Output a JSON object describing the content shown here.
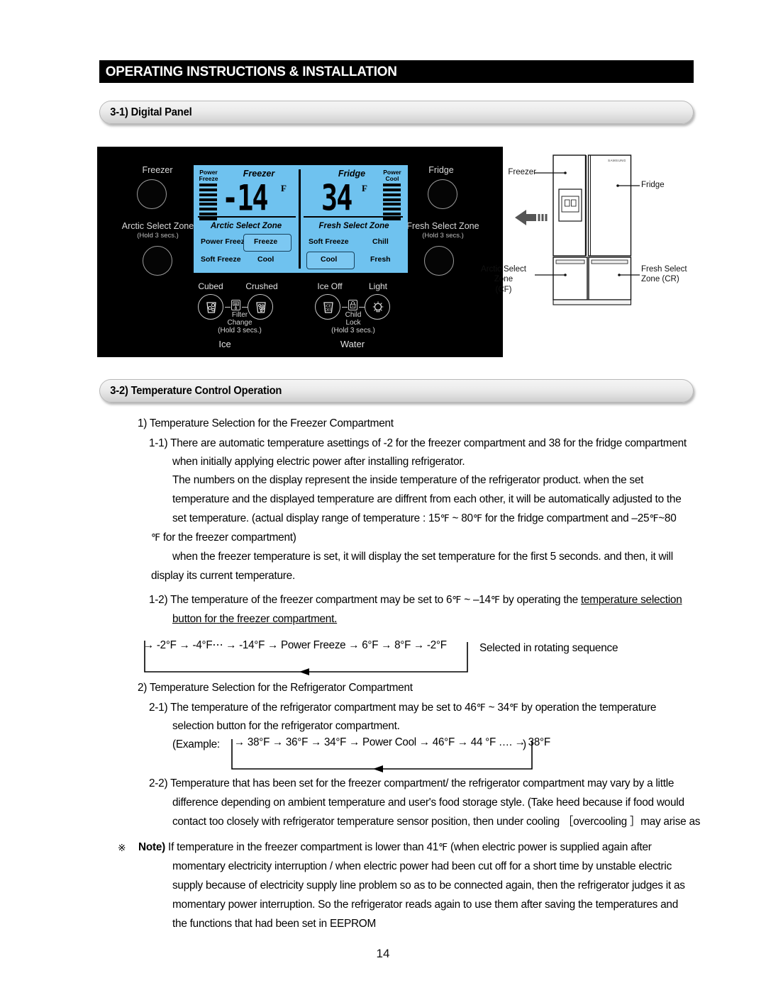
{
  "header": {
    "title": "OPERATING INSTRUCTIONS & INSTALLATION"
  },
  "sections": {
    "digital_panel": "3-1) Digital Panel",
    "temperature_control": "3-2) Temperature Control Operation"
  },
  "digital_panel": {
    "left_controls": [
      {
        "label": "Freezer",
        "sub": ""
      },
      {
        "label": "Arctic Select Zone",
        "sub": "(Hold 3 secs.)"
      }
    ],
    "right_controls": [
      {
        "label": "Fridge",
        "sub": ""
      },
      {
        "label": "Fresh Select Zone",
        "sub": "(Hold 3 secs.)"
      }
    ],
    "lcd": {
      "power_freeze_label": "Power\nFreeze",
      "power_cool_label": "Power\nCool",
      "freezer_title": "Freezer",
      "fridge_title": "Fridge",
      "freezer_value": "-14",
      "freezer_unit": "F",
      "fridge_value": "34",
      "fridge_unit": "F",
      "arctic_zone_title": "Arctic Select Zone",
      "fresh_zone_title": "Fresh Select Zone",
      "arctic_items": [
        "Power Freeze",
        "Freeze",
        "Soft Freeze",
        "Cool"
      ],
      "arctic_selected": "Freeze",
      "fresh_items": [
        "Soft Freeze",
        "Chill",
        "Cool",
        "Fresh"
      ],
      "fresh_selected": "Cool",
      "bar_count": 8,
      "lcd_color": "#6fc2ef"
    },
    "dispenser": {
      "cubed": "Cubed",
      "crushed": "Crushed",
      "ice_off": "Ice Off",
      "light": "Light",
      "filter_change": "Filter\nChange\n(Hold 3 secs.)",
      "child_lock": "Child\nLock\n(Hold 3 secs.)",
      "ice_group": "Ice",
      "water_group": "Water",
      "ice_off_glyph": "ICE\nOFF"
    }
  },
  "fridge_diagram": {
    "brand": "SAMSUNG",
    "callouts": {
      "freezer": "Freezer",
      "fridge": "Fridge",
      "arctic": "Arctic Select Zone\n(CF)",
      "fresh": "Fresh Select\nZone (CR)"
    }
  },
  "body": {
    "item1_head": "1) Temperature Selection for the Freezer Compartment",
    "item1_1_l1": "1-1) There are automatic temperature asettings of -2 for the freezer compartment and 38 for the fridge compartment",
    "item1_1_l2": "when initially applying electric power after installing refrigerator.",
    "p2_l1": "The numbers on the display represent the inside temperature of the refrigerator product. when the set",
    "p2_l2": "temperature and the displayed temperature are diffrent from each other, it will be automatically adjusted to the",
    "p2_l3_a": "set temperature. (actual display range of temperature : 15",
    "p2_l3_b": " ~ 80",
    "p2_l3_c": " for the fridge compartment and –25",
    "p2_l3_d": "~80",
    "p2_l4_a": " for the freezer compartment)",
    "p2_l5": "when the freezer temperature is set, it will display the set temperature for the first 5 seconds. and then, it will",
    "p2_l6": "display its current temperature.",
    "item1_2_a": "1-2) The temperature of the freezer compartment may be set to 6",
    "item1_2_b": " ~ –14",
    "item1_2_c": " by operating the ",
    "item1_2_u1": "temperature selection",
    "item1_2_u2": "button for",
    "item1_2_u3": " the freezer compartment.",
    "seq1": "→ -2°F → -4°F⋯ → -14°F → Power Freeze → 6°F → 8°F → -2°F",
    "seq1_note": "Selected in rotating sequence",
    "item2_head": "2) Temperature Selection for the Refrigerator Compartment",
    "item2_1_a": "2-1) The temperature of the refrigerator compartment may be set to 46",
    "item2_1_b": " ~ 34",
    "item2_1_c": " by operation the temperature",
    "item2_1_l2": "selection button for the refrigerator compartment.",
    "example_label": "(Example:",
    "seq2": "→ 38°F → 36°F → 34°F → Power Cool → 46°F → 44 °F …. → 38°F",
    "example_close": ")",
    "item2_2_l1": "2-2) Temperature that has been set for the freezer compartment/ the refrigerator compartment may vary by a little",
    "item2_2_l2": "difference depending on ambient temperature and user's food storage style. (Take heed because if food would",
    "item2_2_l3": "contact too closely with refrigerator temperature sensor position, then under cooling ［overcooling ］may arise as",
    "note_mark": "※",
    "note_label": "Note)",
    "note_l1_a": " If temperature in the freezer compartment is lower than 41",
    "note_l1_b": " (when electric power is supplied again after",
    "note_l2": "momentary electricity interruption / when electric power had been cut off for a short time by unstable electric",
    "note_l3": "supply because of electricity supply line problem so as to be connected again, then the refrigerator judges it as",
    "note_l4": "momentary power interruption. So the refrigerator reads again to use them after saving the temperatures and",
    "note_l5": "the functions that had been set in EEPROM"
  },
  "page_number": "14",
  "degree_symbol": "℉"
}
